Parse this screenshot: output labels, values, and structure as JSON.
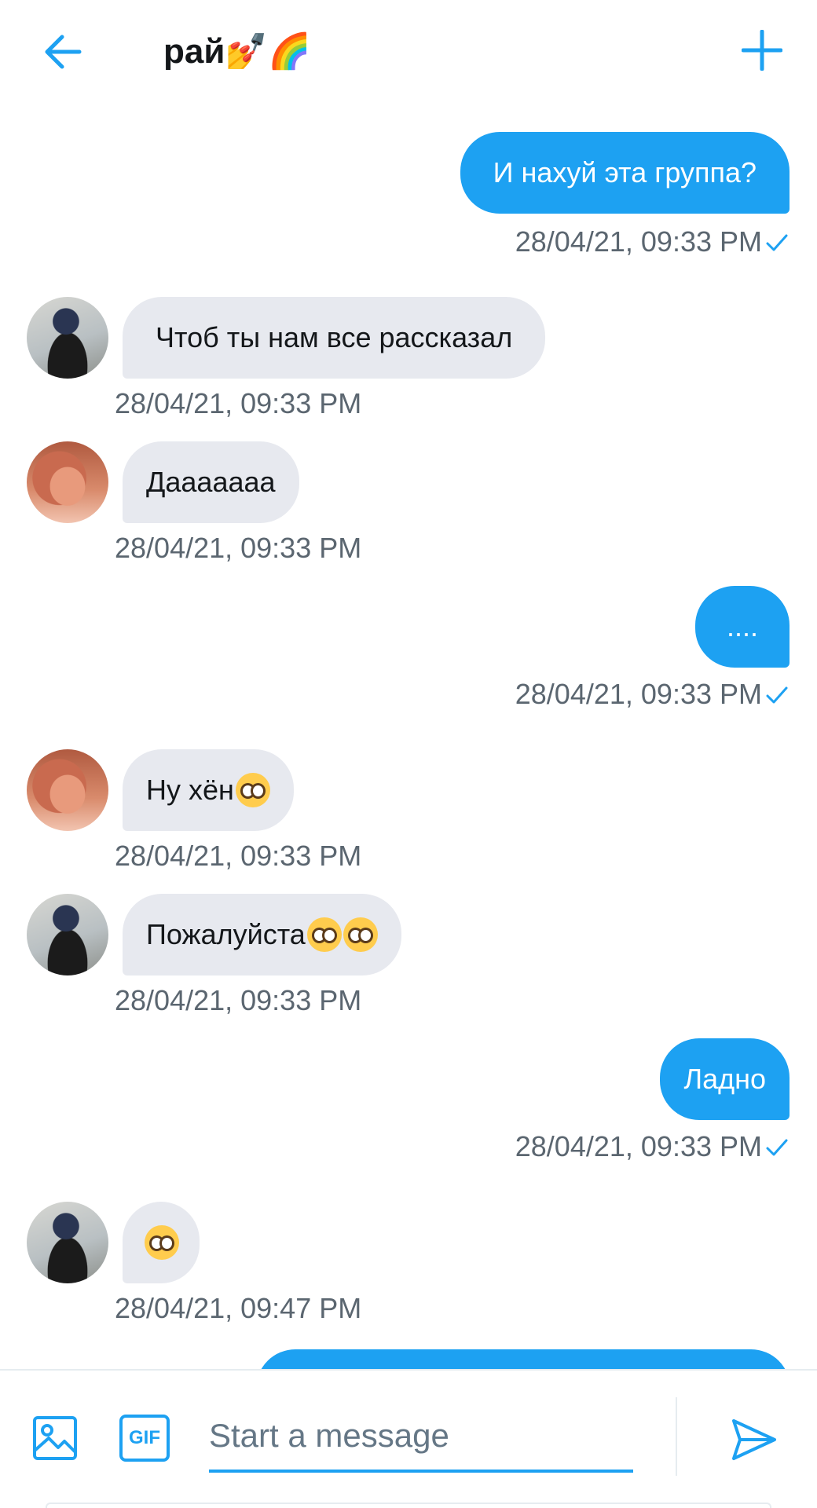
{
  "header": {
    "title": "рай💅🌈"
  },
  "messages": [
    {
      "text": "И нахуй эта группа?",
      "time": "28/04/21, 09:33 PM"
    },
    {
      "text": "Чтоб ты нам все рассказал",
      "time": "28/04/21, 09:33 PM"
    },
    {
      "text": "Дааааааа",
      "time": "28/04/21, 09:33 PM"
    },
    {
      "text": "....",
      "time": "28/04/21, 09:33 PM"
    },
    {
      "text": "Ну хён",
      "time": "28/04/21, 09:33 PM"
    },
    {
      "text": "Пожалуйста ",
      "time": "28/04/21, 09:33 PM"
    },
    {
      "text": "Ладно",
      "time": "28/04/21, 09:33 PM"
    },
    {
      "text": "",
      "time": "28/04/21, 09:47 PM"
    }
  ],
  "composer": {
    "placeholder": "Start a message",
    "gif_label": "GIF"
  },
  "colors": {
    "accent": "#1da1f2",
    "incoming_bubble": "#e7e9ef"
  }
}
